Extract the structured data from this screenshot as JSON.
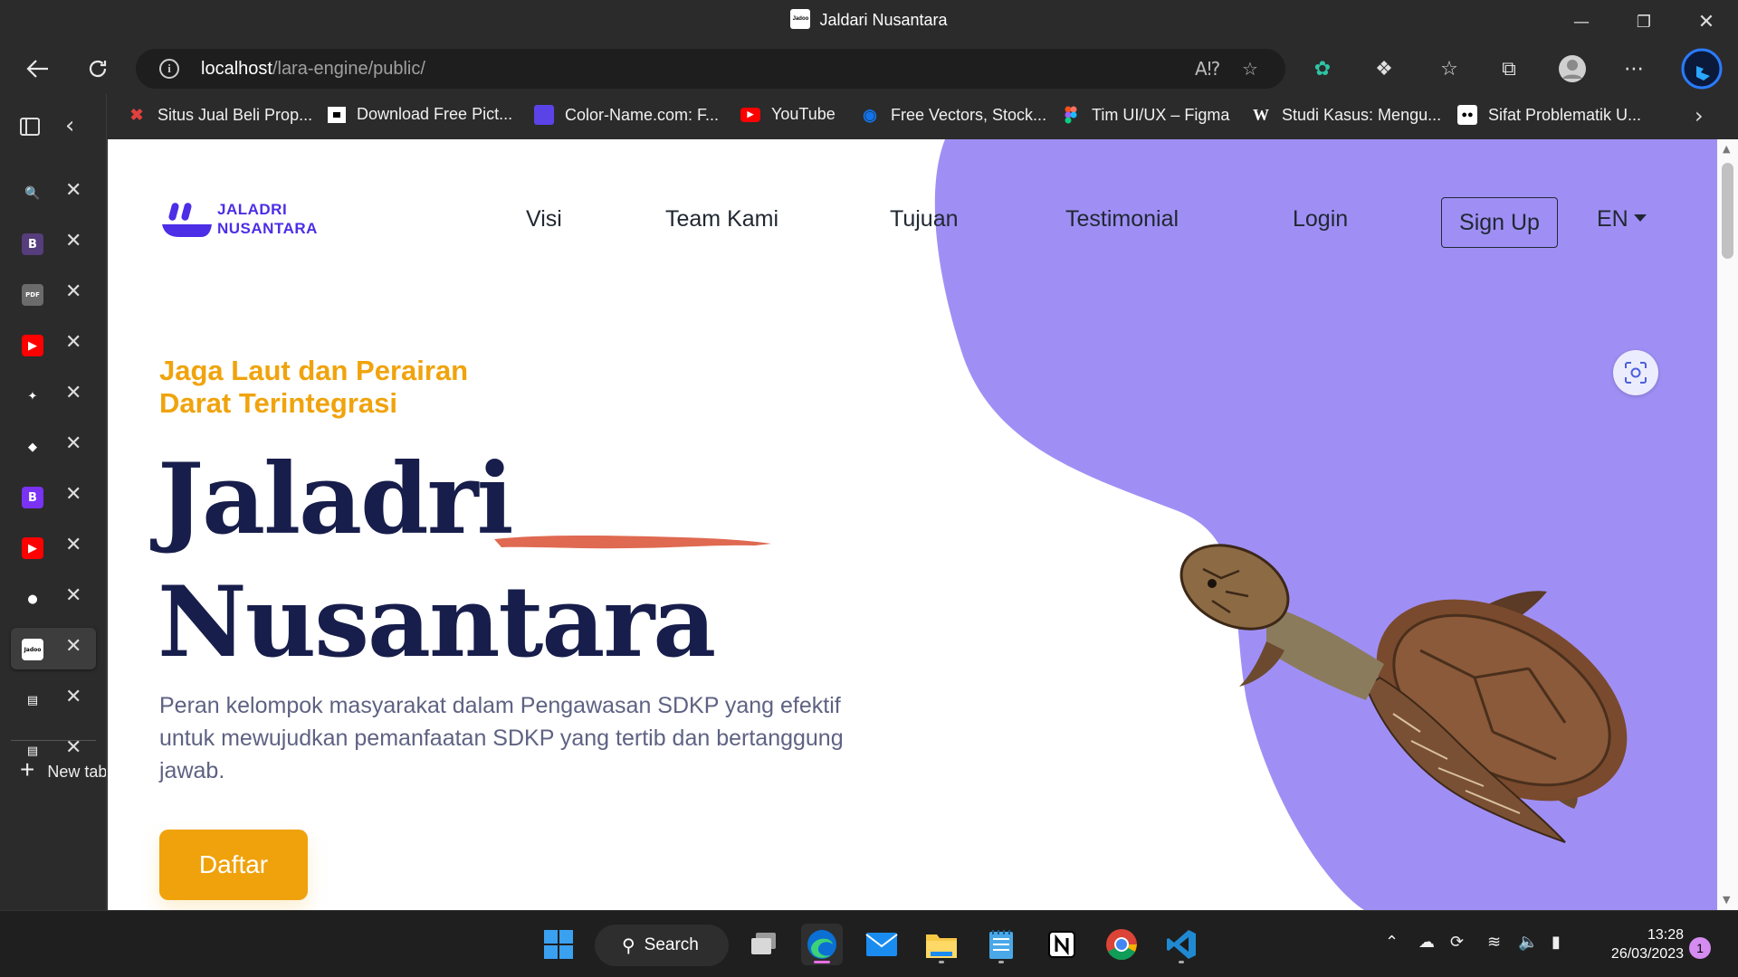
{
  "window": {
    "title": "Jaldari Nusantara",
    "favicon_text": "Jadoo"
  },
  "addressbar": {
    "host": "localhost",
    "path": "/lara-engine/public/"
  },
  "bookmarks": [
    {
      "label": "Situs Jual Beli Prop...",
      "icon": "house-logo-icon",
      "color": "#e0413d"
    },
    {
      "label": "Download Free Pict...",
      "icon": "unsplash-icon",
      "color": "#ffffff"
    },
    {
      "label": "Color-Name.com: F...",
      "icon": "color-name-icon",
      "color": "#5b43e8"
    },
    {
      "label": "YouTube",
      "icon": "youtube-icon",
      "color": "#ff0000"
    },
    {
      "label": "Free Vectors, Stock...",
      "icon": "freepik-icon",
      "color": "#1273eb"
    },
    {
      "label": "Tim UI/UX – Figma",
      "icon": "figma-icon",
      "color": "#f24e1e"
    },
    {
      "label": "Studi Kasus: Mengu...",
      "icon": "w-icon",
      "color": "#000000"
    },
    {
      "label": "Sifat Problematik U...",
      "icon": "medium-icon",
      "color": "#000000"
    }
  ],
  "sidebar": {
    "tabs": [
      {
        "icon": "search-icon",
        "glyph": "🔍",
        "bg": "transparent"
      },
      {
        "icon": "bootstrap-icon",
        "glyph": "B",
        "bg": "#563d7c"
      },
      {
        "icon": "pdf-icon",
        "glyph": "PDF",
        "bg": "#6b6b6b"
      },
      {
        "icon": "youtube-icon",
        "glyph": "▶",
        "bg": "#ff0000"
      },
      {
        "icon": "figma-icon",
        "glyph": "✦",
        "bg": "transparent"
      },
      {
        "icon": "layers-icon",
        "glyph": "◆",
        "bg": "transparent"
      },
      {
        "icon": "bootstrap-icon",
        "glyph": "B",
        "bg": "#7a32f5"
      },
      {
        "icon": "youtube-icon",
        "glyph": "▶",
        "bg": "#ff0000"
      },
      {
        "icon": "github-icon",
        "glyph": "●",
        "bg": "transparent"
      },
      {
        "icon": "jadoo-icon",
        "glyph": "Jadoo",
        "bg": "#ffffff"
      },
      {
        "icon": "calendar-icon",
        "glyph": "▤",
        "bg": "transparent"
      },
      {
        "icon": "calendar-icon",
        "glyph": "▤",
        "bg": "transparent"
      }
    ],
    "active_index": 9,
    "new_tab_label": "New tab"
  },
  "page": {
    "logo_line1": "JALADRI",
    "logo_line2": "NUSANTARA",
    "nav": [
      "Visi",
      "Team Kami",
      "Tujuan",
      "Testimonial",
      "Login"
    ],
    "signup": "Sign Up",
    "lang": "EN",
    "tagline": "Jaga Laut dan Perairan Darat Terintegrasi",
    "headline_1": "Jaladri",
    "headline_2": "Nusantara",
    "description": "Peran kelompok masyarakat dalam Pengawasan SDKP yang efektif untuk mewujudkan pemanfaatan SDKP yang tertib dan bertanggung jawab.",
    "cta": "Daftar",
    "colors": {
      "accent": "#f0a30c",
      "blob": "#9f8ff5",
      "heading": "#181e4b",
      "brand": "#4b2ee6",
      "brush": "#df6951"
    }
  },
  "taskbar": {
    "search_label": "Search",
    "apps": [
      "windows-start-icon",
      "task-view-icon",
      "edge-icon",
      "mail-icon",
      "file-explorer-icon",
      "notepad-icon",
      "notion-icon",
      "chrome-icon",
      "vscode-icon"
    ],
    "time": "13:28",
    "date": "26/03/2023",
    "notifications": "1"
  }
}
